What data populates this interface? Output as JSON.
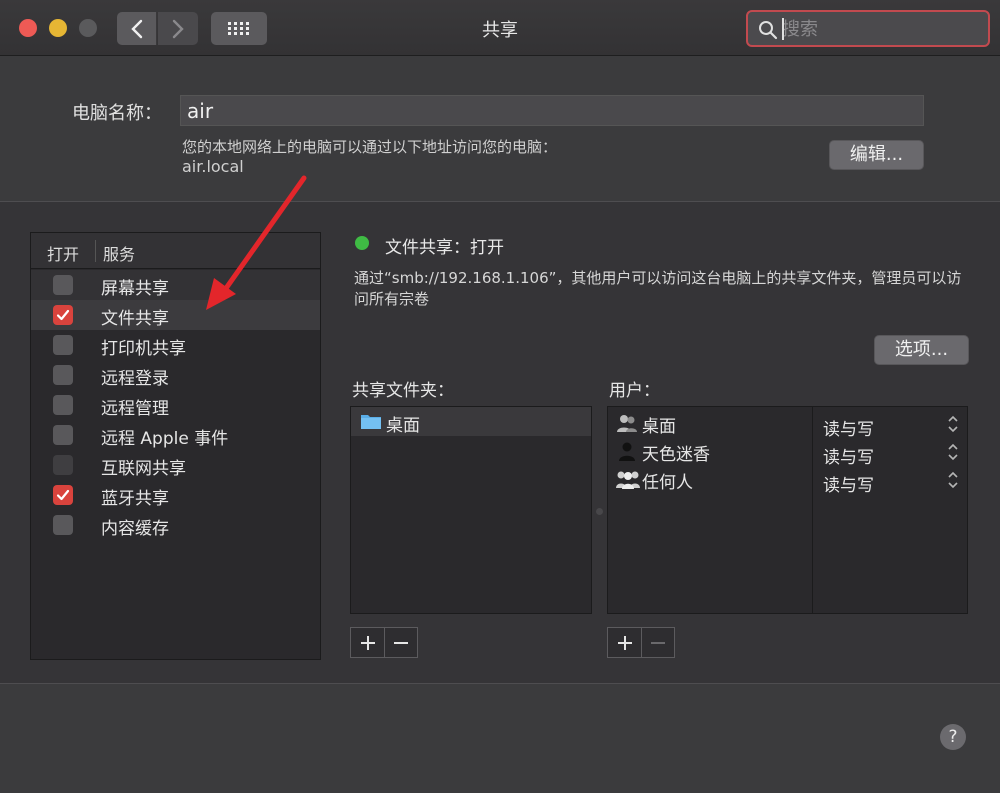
{
  "window": {
    "title": "共享"
  },
  "search": {
    "placeholder": "搜索"
  },
  "computer": {
    "name_label": "电脑名称：",
    "name_value": "air",
    "address_desc": "您的本地网络上的电脑可以通过以下地址访问您的电脑：",
    "address_host": "air.local",
    "edit_label": "编辑..."
  },
  "services": {
    "header_on": "打开",
    "header_service": "服务",
    "items": [
      {
        "label": "屏幕共享",
        "checked": false
      },
      {
        "label": "文件共享",
        "checked": true
      },
      {
        "label": "打印机共享",
        "checked": false
      },
      {
        "label": "远程登录",
        "checked": false
      },
      {
        "label": "远程管理",
        "checked": false
      },
      {
        "label": "远程 Apple 事件",
        "checked": false
      },
      {
        "label": "互联网共享",
        "checked": false
      },
      {
        "label": "蓝牙共享",
        "checked": true
      },
      {
        "label": "内容缓存",
        "checked": false
      }
    ]
  },
  "detail": {
    "status": "文件共享：打开",
    "status_color": "#3fbb44",
    "info": "通过“smb://192.168.1.106”，其他用户可以访问这台电脑上的共享文件夹，管理员可以访问所有宗卷",
    "options_label": "选项...",
    "folders_label": "共享文件夹：",
    "users_label": "用户：",
    "folders": [
      {
        "name": "桌面",
        "icon": "folder-icon"
      }
    ],
    "users": [
      {
        "name": "桌面",
        "icon": "group-users-icon",
        "permission": "读与写"
      },
      {
        "name": "天色迷香",
        "icon": "user-icon",
        "permission": "读与写"
      },
      {
        "name": "任何人",
        "icon": "everyone-icon",
        "permission": "读与写"
      }
    ]
  },
  "help": {
    "label": "?"
  },
  "colors": {
    "check_on": "#d9433d",
    "search_focus": "#c24a4f",
    "arrow": "#e3262b"
  }
}
